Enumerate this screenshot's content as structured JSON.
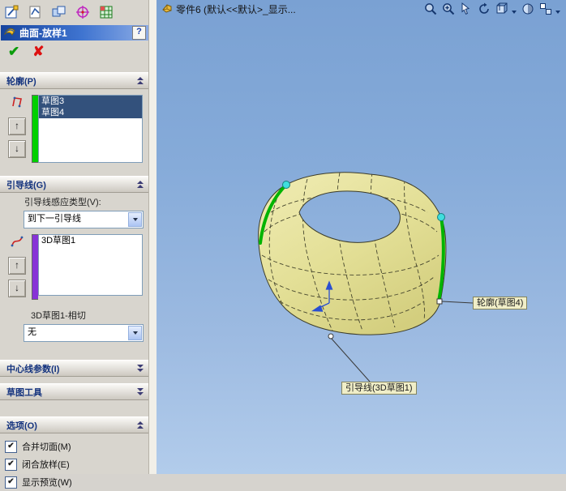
{
  "glyphs": {
    "ok": "✔",
    "cancel": "✘",
    "help": "?",
    "up": "↑",
    "down": "↓",
    "check": "✔"
  },
  "panel": {
    "title": "曲面-放样1",
    "profiles": {
      "header": "轮廓(P)",
      "items": [
        "草图3",
        "草图4"
      ]
    },
    "guides": {
      "header": "引导线(G)",
      "influence_label": "引导线感应类型(V):",
      "influence_value": "到下一引导线",
      "items": [
        "3D草图1"
      ],
      "tangency_label": "3D草图1-相切",
      "tangency_value": "无"
    },
    "centerline": {
      "header": "中心线参数(I)"
    },
    "sketch_tools": {
      "header": "草图工具"
    },
    "options": {
      "header": "选项(O)",
      "checkboxes": [
        {
          "label": "合并切面(M)",
          "checked": true
        },
        {
          "label": "闭合放样(E)",
          "checked": true
        },
        {
          "label": "显示预览(W)",
          "checked": true
        }
      ]
    }
  },
  "viewport": {
    "doc_title": "零件6 (默认<<默认>_显示...",
    "toolbar_icons": [
      "zoom-fit",
      "zoom-area",
      "zoom-pointer",
      "rotate-view",
      "view-orientation",
      "display-style",
      "standard-views"
    ],
    "callouts": {
      "profile": "轮廓(草图4)",
      "guide": "引导线(3D草图1)"
    }
  },
  "toolbar_icons": [
    "sketch",
    "3d-sketch",
    "sketch-settings",
    "point",
    "grid-settings"
  ],
  "colors": {
    "title_gradient_start": "#16449e",
    "viewport_top": "#7aa1d3",
    "viewport_bottom": "#b2cceb",
    "model_fill": "#e3df96",
    "edge_green": "#00b400",
    "vertex_cyan": "#3fdede",
    "selection_bg": "#33517c",
    "profile_bar": "#00d000",
    "guide_bar": "#8733d6",
    "callout_bg": "#f0eec8"
  }
}
